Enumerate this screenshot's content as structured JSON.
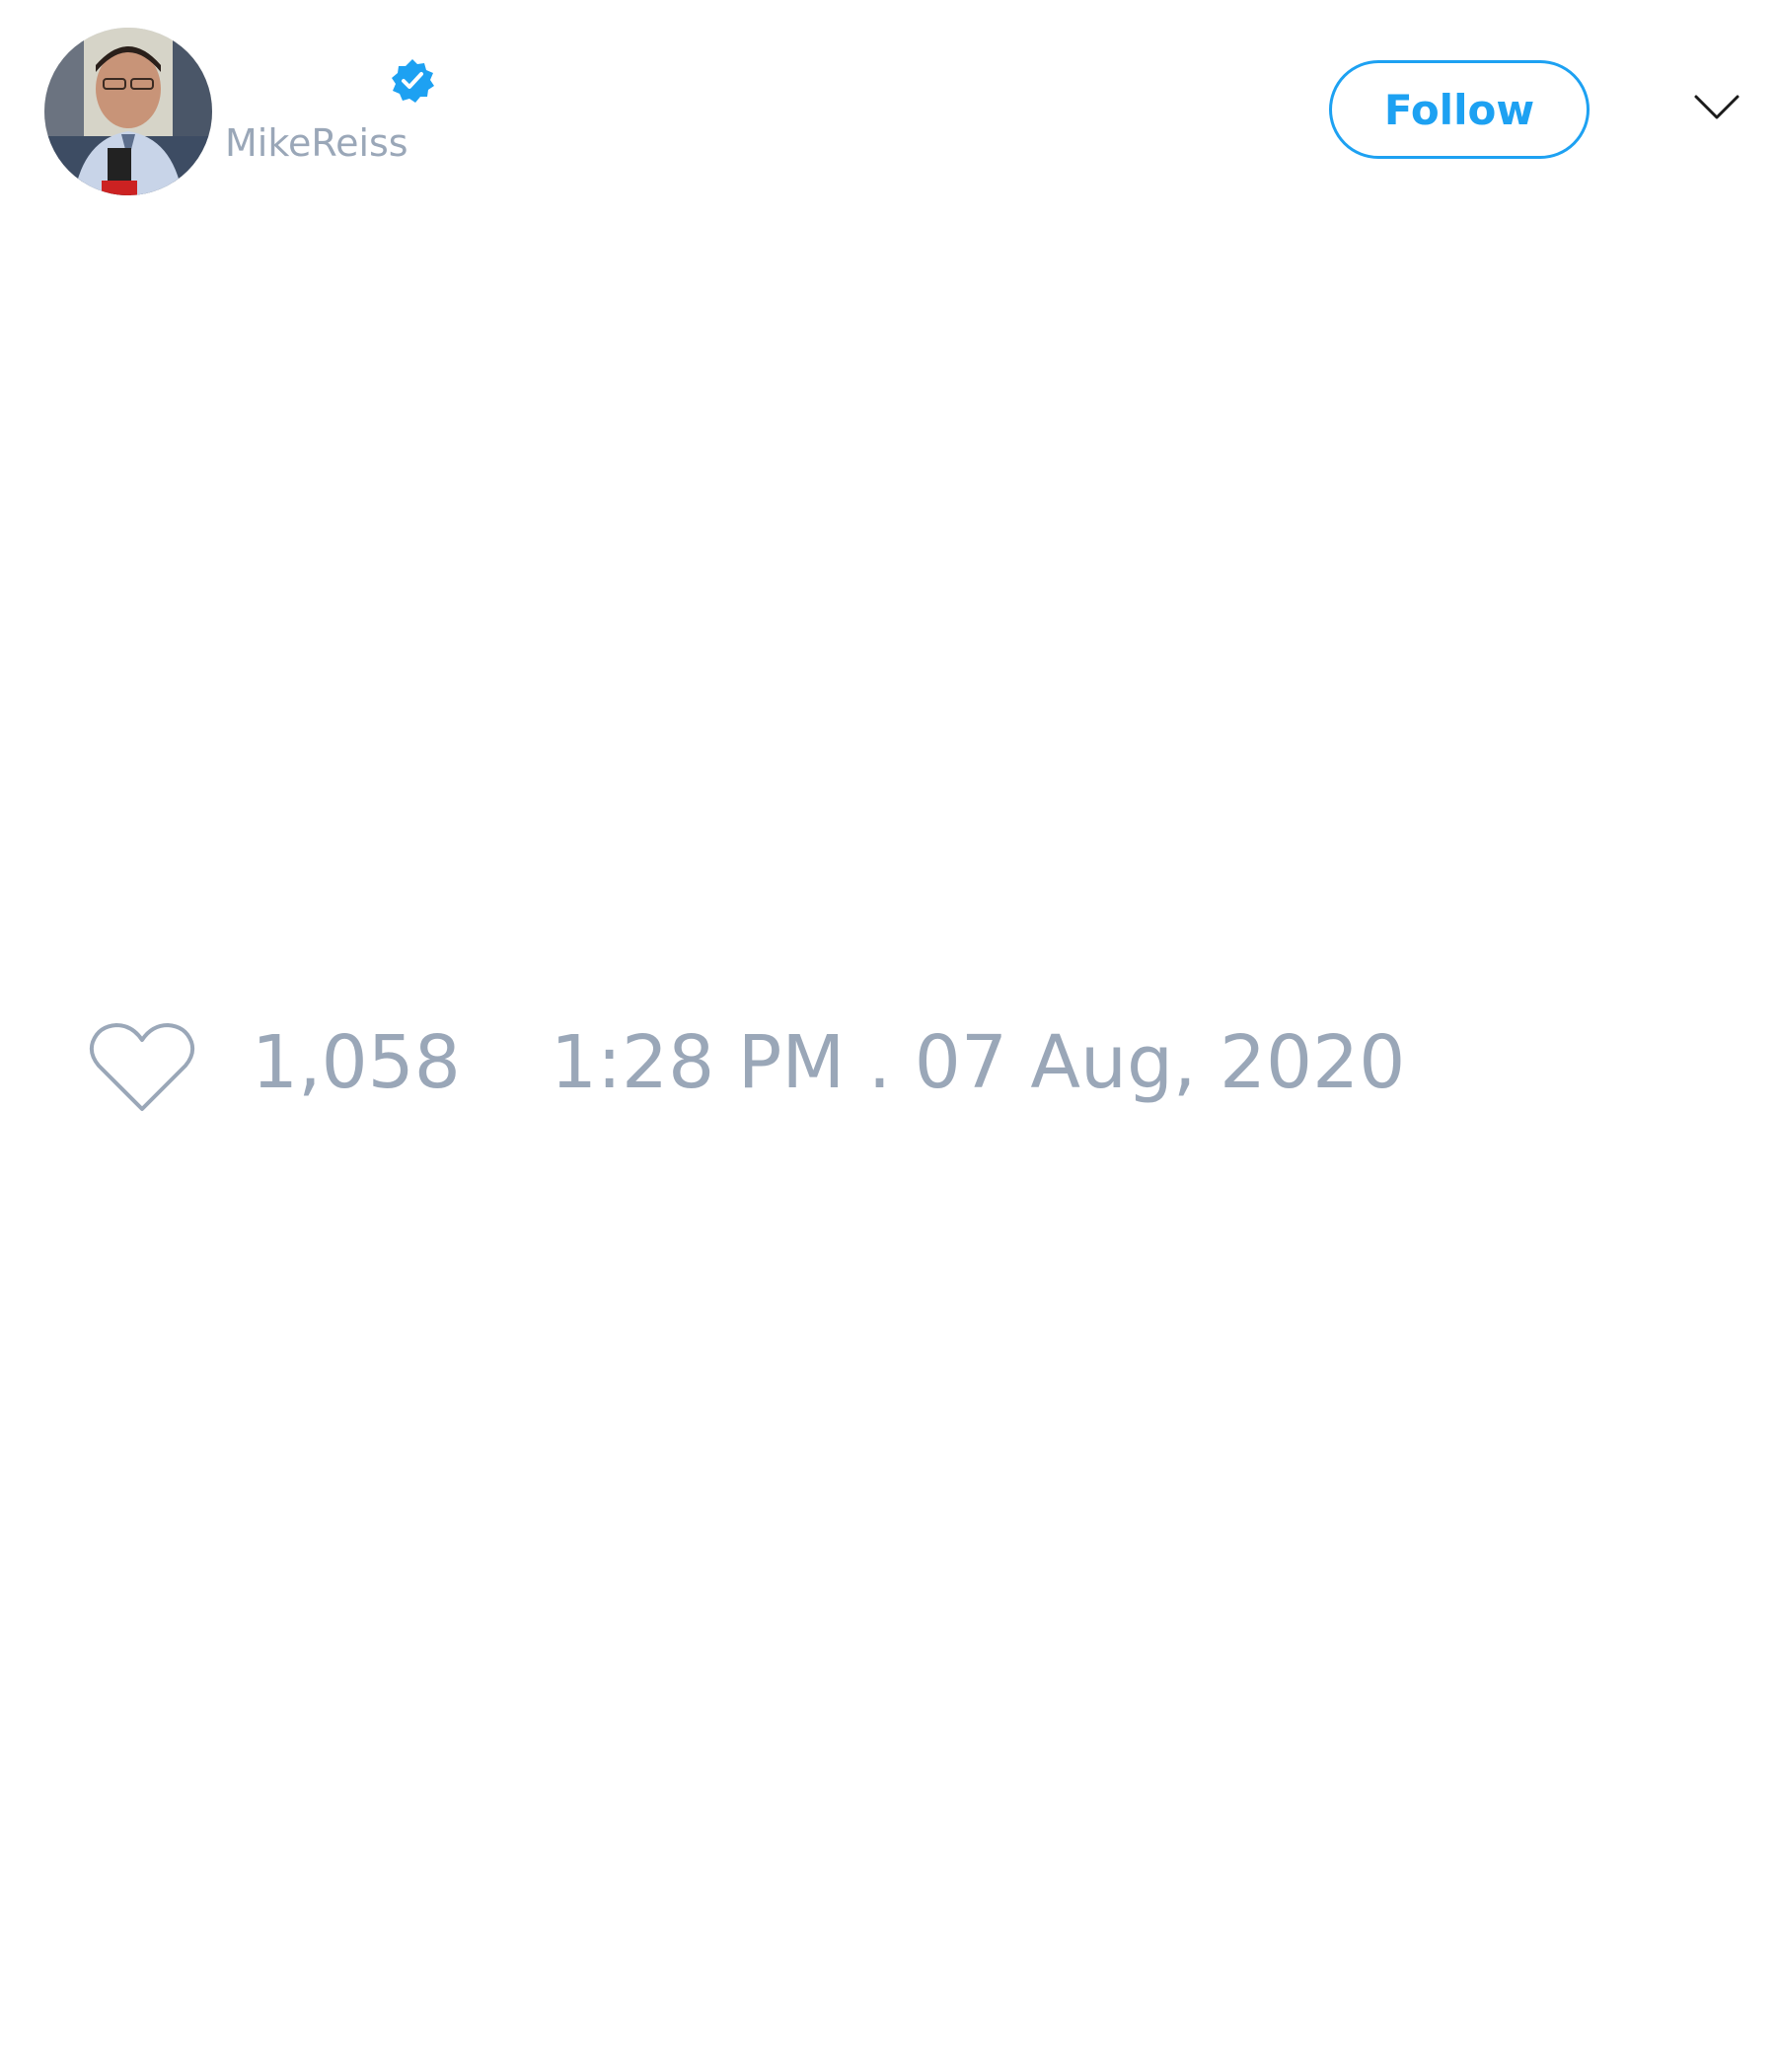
{
  "header": {
    "avatar_icon": "avatar-photo",
    "verified_icon": "verified-badge-icon",
    "username": "MikeReiss",
    "follow_label": "Follow",
    "menu_icon": "chevron-down-icon"
  },
  "meta": {
    "like_icon": "heart-icon",
    "like_count": "1,058",
    "timestamp": "1:28 PM . 07 Aug, 2020"
  },
  "colors": {
    "accent": "#1da1f2",
    "muted_text": "#9aa7b8"
  }
}
